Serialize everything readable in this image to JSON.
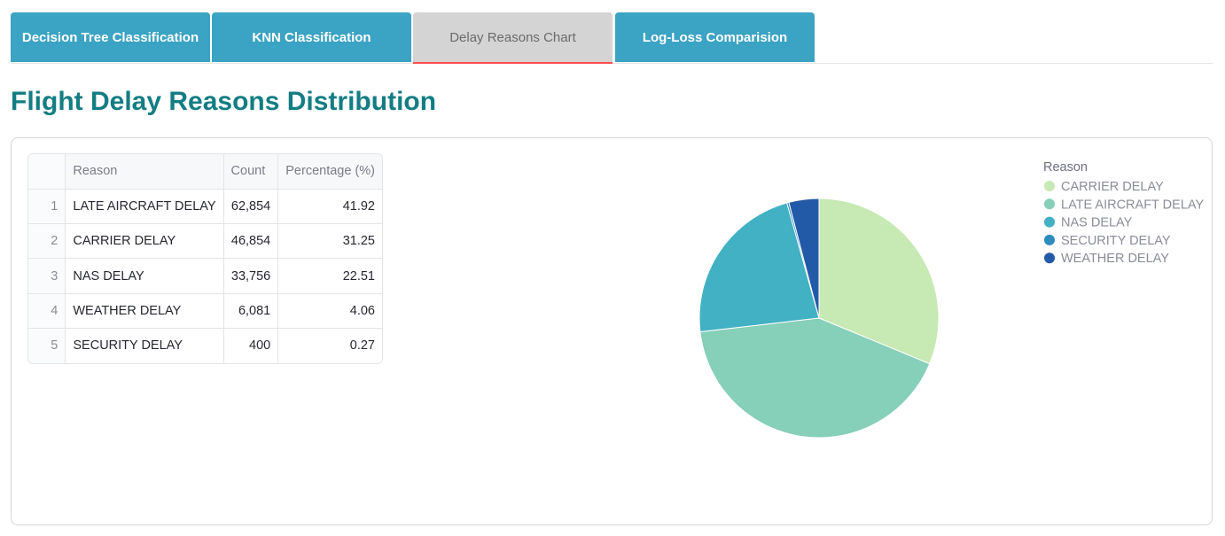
{
  "tabs": [
    {
      "label": "Decision Tree Classification",
      "active": false
    },
    {
      "label": "KNN Classification",
      "active": false
    },
    {
      "label": "Delay Reasons Chart",
      "active": true
    },
    {
      "label": "Log-Loss Comparision",
      "active": false
    }
  ],
  "page_title": "Flight Delay Reasons Distribution",
  "table": {
    "columns": [
      "",
      "Reason",
      "Count",
      "Percentage (%)"
    ],
    "rows": [
      {
        "index": "1",
        "reason": "LATE AIRCRAFT DELAY",
        "count": "62,854",
        "percentage": "41.92"
      },
      {
        "index": "2",
        "reason": "CARRIER DELAY",
        "count": "46,854",
        "percentage": "31.25"
      },
      {
        "index": "3",
        "reason": "NAS DELAY",
        "count": "33,756",
        "percentage": "22.51"
      },
      {
        "index": "4",
        "reason": "WEATHER DELAY",
        "count": "6,081",
        "percentage": "4.06"
      },
      {
        "index": "5",
        "reason": "SECURITY DELAY",
        "count": "400",
        "percentage": "0.27"
      }
    ]
  },
  "chart_data": {
    "type": "pie",
    "legend_title": "Reason",
    "legend_position": "top-right",
    "categories": [
      "CARRIER DELAY",
      "LATE AIRCRAFT DELAY",
      "NAS DELAY",
      "SECURITY DELAY",
      "WEATHER DELAY"
    ],
    "values": [
      31.25,
      41.92,
      22.51,
      0.27,
      4.06
    ],
    "colors": [
      "#c7e9b4",
      "#86cfb9",
      "#42b1c3",
      "#2c8cc0",
      "#235aa8"
    ]
  },
  "colors": {
    "tab_bg": "#3ba3c3",
    "tab_active_bg": "#d4d4d4",
    "tab_active_indicator": "#ff4b4b",
    "title": "#137d83"
  }
}
